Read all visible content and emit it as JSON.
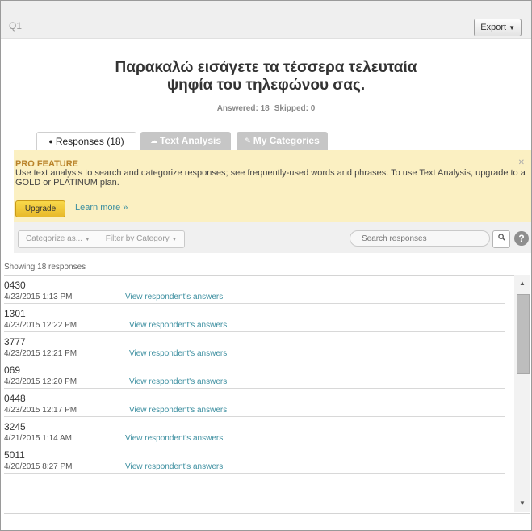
{
  "header": {
    "question_label": "Q1",
    "export_label": "Export",
    "export_caret": "▼"
  },
  "question": {
    "line1": "Παρακαλώ εισάγετε τα τέσσερα τελευταία",
    "line2": "ψηφία του τηλεφώνου σας."
  },
  "stats": {
    "answered": "Answered: 18",
    "skipped": "Skipped: 0"
  },
  "tabs": {
    "responses": {
      "label": "Responses",
      "count": "(18)"
    },
    "text_analysis": {
      "label": "Text Analysis"
    },
    "my_categories": {
      "label": "My Categories"
    }
  },
  "pro": {
    "title": "PRO FEATURE",
    "text": "Use text analysis to search and categorize responses; see frequently-used words and phrases. To use Text Analysis, upgrade to a GOLD or PLATINUM plan.",
    "upgrade_label": "Upgrade",
    "learn_more": "Learn more »"
  },
  "filters": {
    "categorize_label": "Categorize as...",
    "filter_label": "Filter by Category",
    "caret": "▼",
    "search_placeholder": "Search responses",
    "help": "?"
  },
  "showing": "Showing 18 responses",
  "view_link": "View respondent's answers",
  "responses": [
    {
      "value": "0430",
      "date": "4/23/2015 1:13 PM"
    },
    {
      "value": "1301",
      "date": "4/23/2015 12:22 PM"
    },
    {
      "value": "3777",
      "date": "4/23/2015 12:21 PM"
    },
    {
      "value": "069",
      "date": "4/23/2015 12:20 PM"
    },
    {
      "value": "0448",
      "date": "4/23/2015 12:17 PM"
    },
    {
      "value": "3245",
      "date": "4/21/2015 1:14 AM"
    },
    {
      "value": "5011",
      "date": "4/20/2015 8:27 PM"
    }
  ],
  "colors": {
    "accent_link": "#3d8fa0",
    "pro_bg": "#fbf0c2",
    "upgrade_btn": "#f0c93a"
  }
}
